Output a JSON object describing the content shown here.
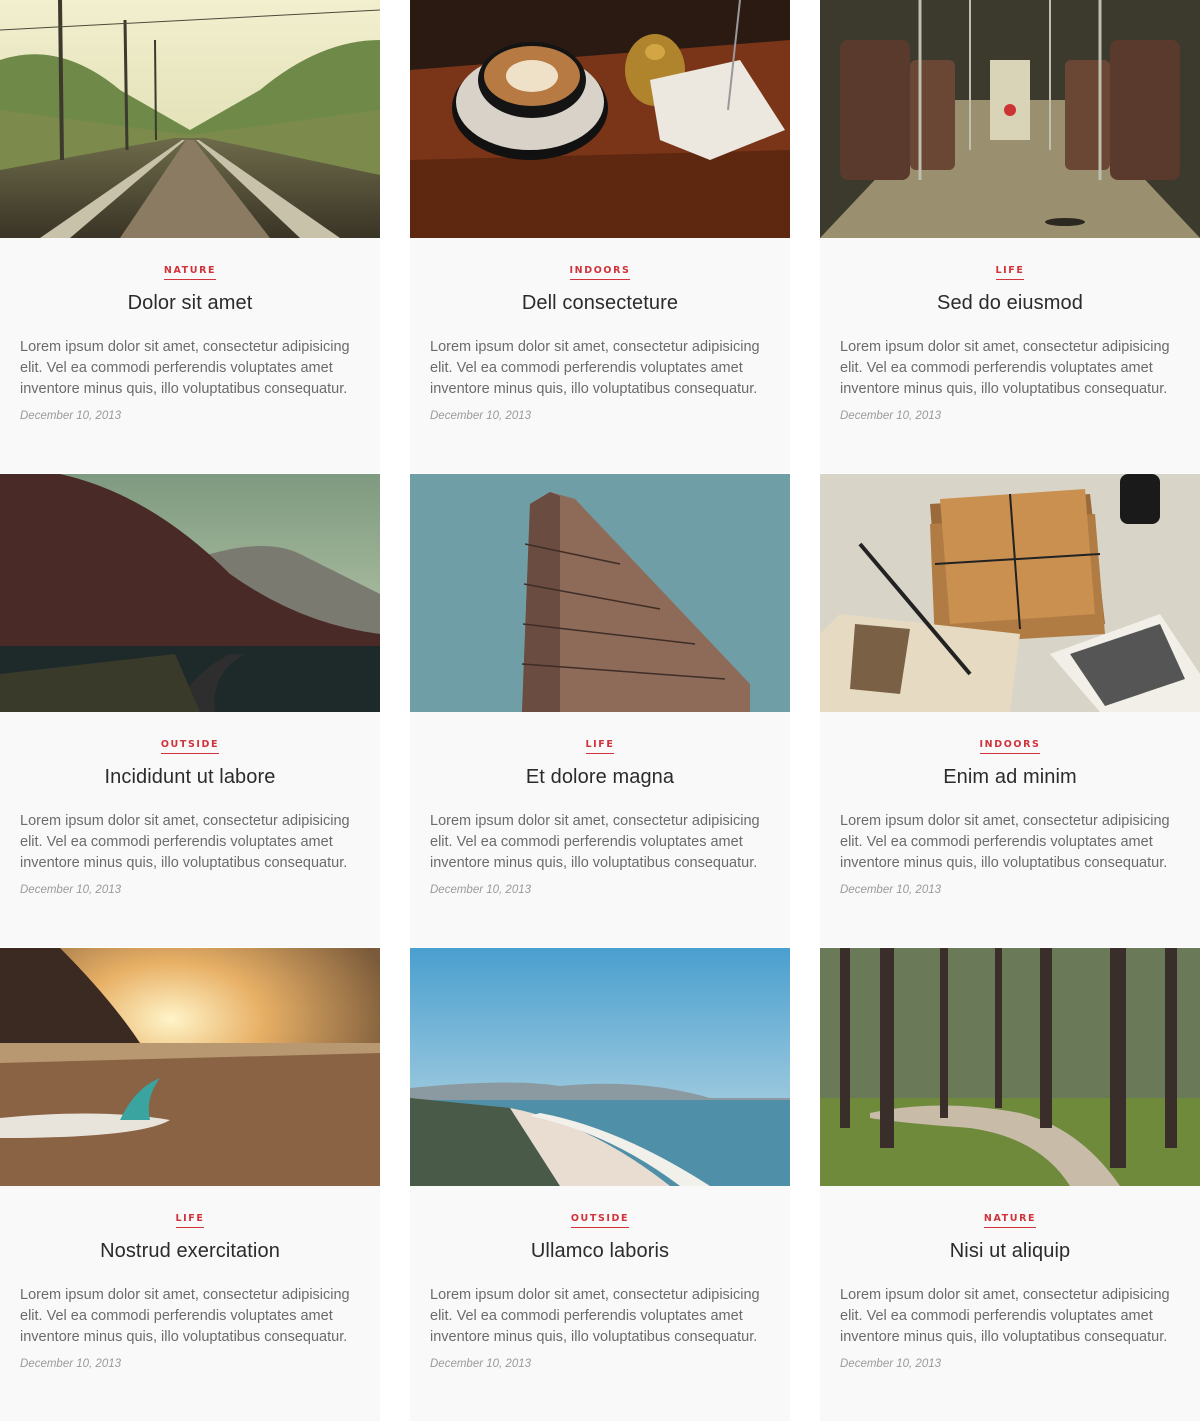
{
  "posts": [
    {
      "category": "NATURE",
      "title": "Dolor sit amet",
      "excerpt": "Lorem ipsum dolor sit amet, consectetur adipisicing elit. Vel ea commodi perferendis voluptates amet inventore minus quis, illo voluptatibus consequatur.",
      "date": "December 10, 2013",
      "image": "railroad-tracks"
    },
    {
      "category": "INDOORS",
      "title": "Dell consecteture",
      "excerpt": "Lorem ipsum dolor sit amet, consectetur adipisicing elit. Vel ea commodi perferendis voluptates amet inventore minus quis, illo voluptatibus consequatur.",
      "date": "December 10, 2013",
      "image": "coffee-cup"
    },
    {
      "category": "LIFE",
      "title": "Sed do eiusmod",
      "excerpt": "Lorem ipsum dolor sit amet, consectetur adipisicing elit. Vel ea commodi perferendis voluptates amet inventore minus quis, illo voluptatibus consequatur.",
      "date": "December 10, 2013",
      "image": "tram-interior"
    },
    {
      "category": "OUTSIDE",
      "title": "Incididunt ut labore",
      "excerpt": "Lorem ipsum dolor sit amet, consectetur adipisicing elit. Vel ea commodi perferendis voluptates amet inventore minus quis, illo voluptatibus consequatur.",
      "date": "December 10, 2013",
      "image": "mountain-road"
    },
    {
      "category": "LIFE",
      "title": "Et dolore magna",
      "excerpt": "Lorem ipsum dolor sit amet, consectetur adipisicing elit. Vel ea commodi perferendis voluptates amet inventore minus quis, illo voluptatibus consequatur.",
      "date": "December 10, 2013",
      "image": "flatiron-building"
    },
    {
      "category": "INDOORS",
      "title": "Enim ad minim",
      "excerpt": "Lorem ipsum dolor sit amet, consectetur adipisicing elit. Vel ea commodi perferendis voluptates amet inventore minus quis, illo voluptatibus consequatur.",
      "date": "December 10, 2013",
      "image": "letters-bundle"
    },
    {
      "category": "LIFE",
      "title": "Nostrud exercitation",
      "excerpt": "Lorem ipsum dolor sit amet, consectetur adipisicing elit. Vel ea commodi perferendis voluptates amet inventore minus quis, illo voluptatibus consequatur.",
      "date": "December 10, 2013",
      "image": "beach-surfboard"
    },
    {
      "category": "OUTSIDE",
      "title": "Ullamco laboris",
      "excerpt": "Lorem ipsum dolor sit amet, consectetur adipisicing elit. Vel ea commodi perferendis voluptates amet inventore minus quis, illo voluptatibus consequatur.",
      "date": "December 10, 2013",
      "image": "coastline"
    },
    {
      "category": "NATURE",
      "title": "Nisi ut aliquip",
      "excerpt": "Lorem ipsum dolor sit amet, consectetur adipisicing elit. Vel ea commodi perferendis voluptates amet inventore minus quis, illo voluptatibus consequatur.",
      "date": "December 10, 2013",
      "image": "forest-path"
    }
  ],
  "colors": {
    "accent": "#d0333b",
    "card_background": "#f9f9f9",
    "title": "#2b2b2b",
    "excerpt": "#6b6b6b",
    "date": "#9a9a9a"
  }
}
